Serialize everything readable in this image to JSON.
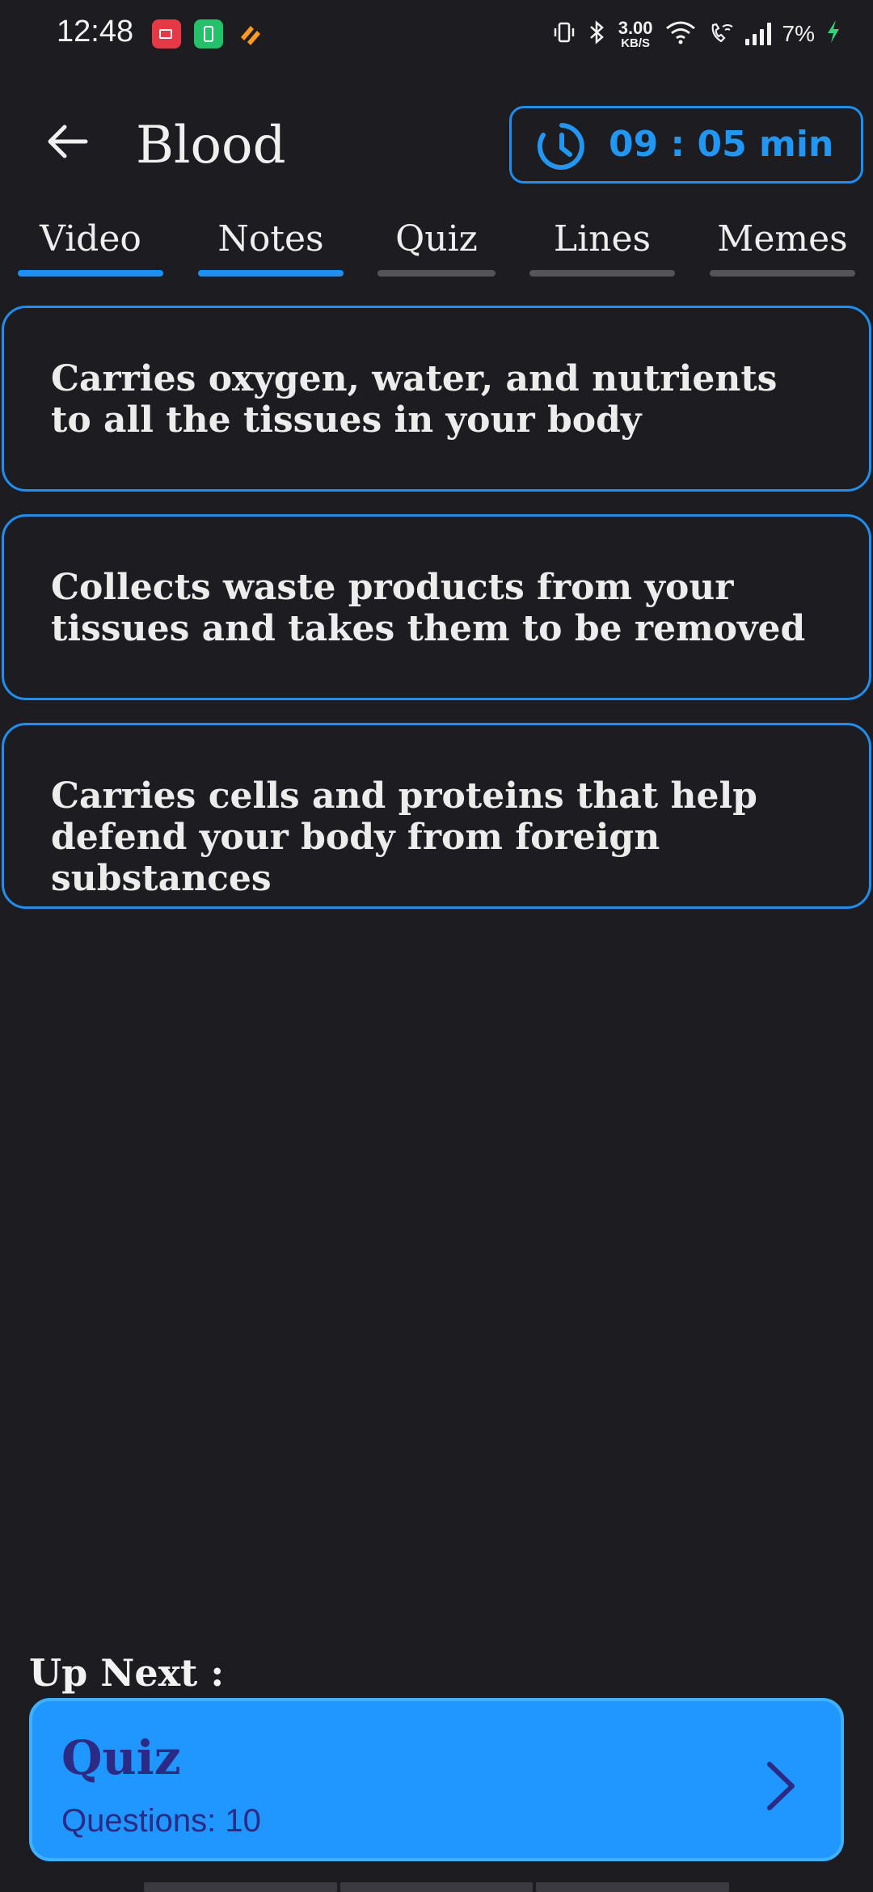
{
  "status_bar": {
    "time": "12:48",
    "notification_icons": [
      "screen-record-icon",
      "battery-saver-icon",
      "app-notification-icon"
    ],
    "net_speed_value": "3.00",
    "net_speed_unit": "KB/S",
    "battery": "7%",
    "icons": [
      "vibrate-icon",
      "bluetooth-icon",
      "wifi-icon",
      "wifi-calling-icon",
      "signal-icon",
      "charging-icon"
    ]
  },
  "header": {
    "back_icon": "arrow-left-icon",
    "title": "Blood",
    "timer": "09 : 05 min",
    "timer_icon": "clock-icon"
  },
  "tabs": [
    {
      "label": "Video",
      "active": true
    },
    {
      "label": "Notes",
      "active": true
    },
    {
      "label": "Quiz",
      "active": false
    },
    {
      "label": "Lines",
      "active": false
    },
    {
      "label": "Memes",
      "active": false
    }
  ],
  "notes": [
    {
      "text": "Carries oxygen, water, and nutrients to all the tissues in your body"
    },
    {
      "text": "Collects waste products from your tissues and takes them to be removed"
    },
    {
      "text": "Carries cells and proteins that help defend your body from foreign substances"
    }
  ],
  "up_next": {
    "label": "Up Next :",
    "title": "Quiz",
    "subtitle": "Questions: 10",
    "chevron_icon": "chevron-right-icon"
  },
  "colors": {
    "background": "#1c1c21",
    "accent": "#1f8ef0",
    "card": "#1f97ff",
    "card_text": "#2c2a84",
    "inactive_tab": "#555559"
  }
}
